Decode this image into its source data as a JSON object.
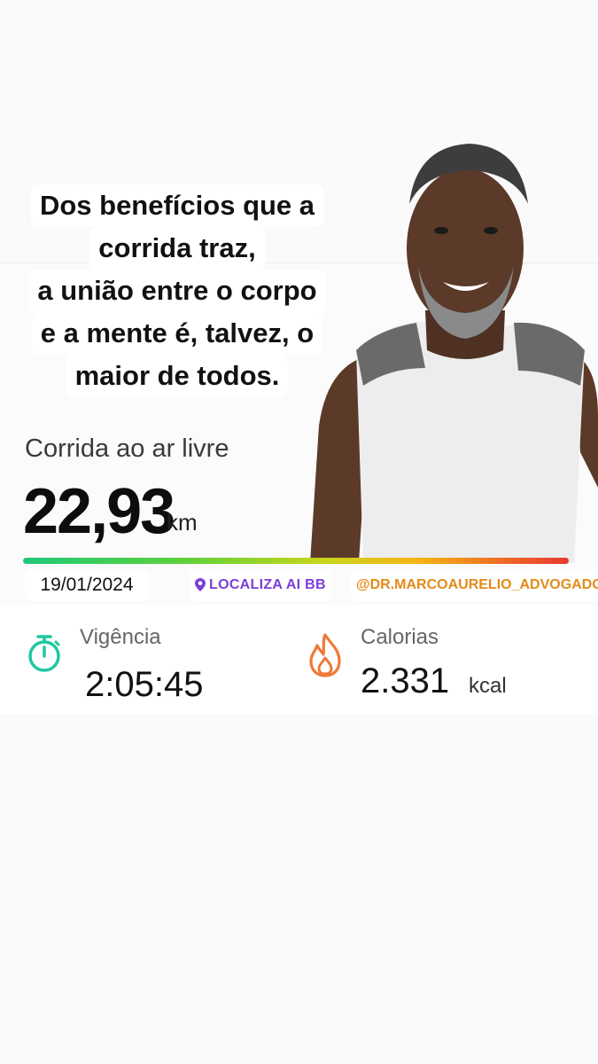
{
  "caption": {
    "lines": [
      "Dos benefícios que a",
      "corrida traz,",
      "a união entre o corpo",
      "e a mente é, talvez, o",
      "maior de todos."
    ]
  },
  "activity": {
    "type": "Corrida ao ar livre",
    "distance": "22,93",
    "distance_unit": "km"
  },
  "tags": {
    "date": "19/01/2024",
    "location": "LOCALIZA AI BB",
    "handle": "@DR.MARCOAURELIO_ADVOGADO"
  },
  "metrics": {
    "duration_label": "Vigência",
    "duration_value": "2:05:45",
    "calories_label": "Calorias",
    "calories_value": "2.331",
    "calories_unit": "kcal"
  },
  "icons": {
    "duration": "stopwatch-icon",
    "calories": "flame-icon",
    "location": "pin-icon"
  },
  "colors": {
    "stopwatch": "#1ec8a0",
    "flame": "#ee7a3a",
    "location_text": "#7a3fd6",
    "handle_text": "#e38b1a",
    "progress_gradient": [
      "#1fc97a",
      "#c8d61c",
      "#f4b514",
      "#e8372d"
    ]
  }
}
